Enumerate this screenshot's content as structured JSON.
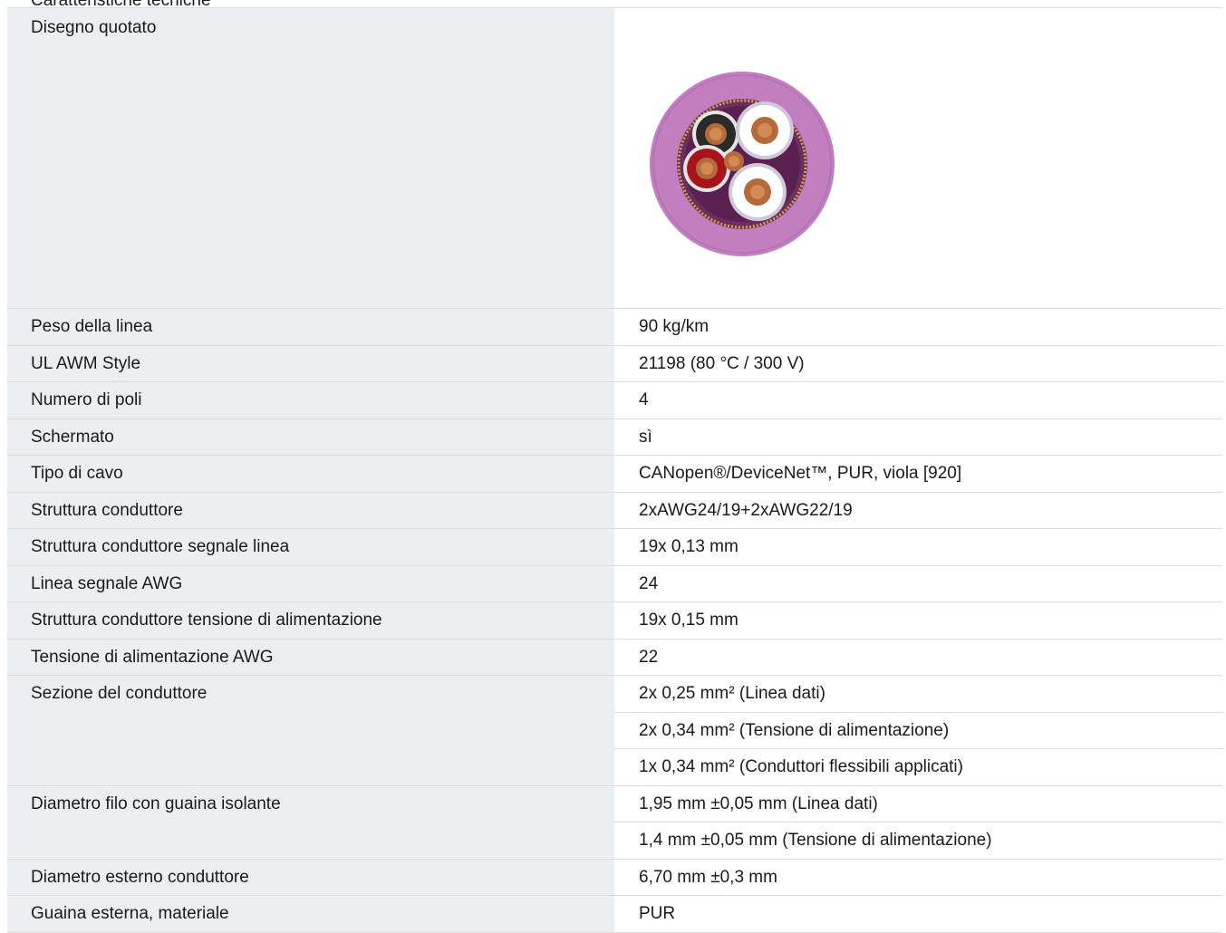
{
  "header": {
    "cut_text": "Caratteristiche tecniche"
  },
  "drawing": {
    "label": "Disegno quotato",
    "image_icon": "cable-cross-section-icon"
  },
  "specs": [
    {
      "label": "Peso della linea",
      "values": [
        "90 kg/km"
      ]
    },
    {
      "label": "UL AWM Style",
      "values": [
        "21198 (80 °C / 300 V)"
      ]
    },
    {
      "label": "Numero di poli",
      "values": [
        "4"
      ]
    },
    {
      "label": "Schermato",
      "values": [
        "sì"
      ]
    },
    {
      "label": "Tipo di cavo",
      "values": [
        "CANopen®/DeviceNet™, PUR, viola [920]"
      ]
    },
    {
      "label": "Struttura conduttore",
      "values": [
        "2xAWG24/19+2xAWG22/19"
      ]
    },
    {
      "label": "Struttura conduttore segnale linea",
      "values": [
        "19x 0,13 mm"
      ]
    },
    {
      "label": "Linea segnale AWG",
      "values": [
        "24"
      ]
    },
    {
      "label": "Struttura conduttore tensione di alimentazione",
      "values": [
        "19x 0,15 mm"
      ]
    },
    {
      "label": "Tensione di alimentazione AWG",
      "values": [
        "22"
      ]
    },
    {
      "label": "Sezione del conduttore",
      "values": [
        "2x 0,25 mm² (Linea dati)",
        "2x 0,34 mm² (Tensione di alimentazione)",
        "1x 0,34 mm² (Conduttori flessibili applicati)"
      ]
    },
    {
      "label": "Diametro filo con guaina isolante",
      "values": [
        "1,95 mm ±0,05 mm (Linea dati)",
        "1,4 mm ±0,05 mm (Tensione di alimentazione)"
      ]
    },
    {
      "label": "Diametro esterno conduttore",
      "values": [
        "6,70 mm ±0,3 mm"
      ]
    },
    {
      "label": "Guaina esterna, materiale",
      "values": [
        "PUR"
      ]
    }
  ],
  "colors": {
    "label_background": "#eceff2",
    "row_border": "#dcdcdc",
    "cable_jacket": "#c27fc0"
  }
}
